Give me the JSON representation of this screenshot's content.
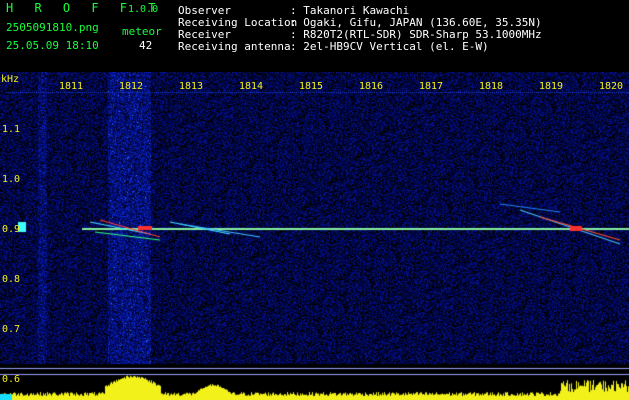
{
  "header": {
    "app_name": "H R O F F T",
    "version": "1.0.0",
    "file_name": "2505091810.png",
    "timestamp": "25.05.09 18:10",
    "count_label": "meteor",
    "count_value": "42",
    "info": [
      {
        "key": "Observer",
        "value": ": Takanori Kawachi"
      },
      {
        "key": "Receiving Location",
        "value": ": Ogaki, Gifu, JAPAN (136.60E, 35.35N)"
      },
      {
        "key": "Receiver",
        "value": ": R820T2(RTL-SDR) SDR-Sharp 53.1000MHz"
      },
      {
        "key": "Receiving antenna",
        "value": ": 2el-HB9CV Vertical (el. E-W)"
      }
    ]
  },
  "axes": {
    "unit_label": "kHz",
    "time_ticks": [
      "1811",
      "1812",
      "1813",
      "1814",
      "1815",
      "1816",
      "1817",
      "1818",
      "1819",
      "1820"
    ],
    "freq_ticks": [
      "1.1",
      "1.0",
      "0.9",
      "0.8",
      "0.7",
      "0.6"
    ]
  },
  "colors": {
    "background": "#000000",
    "header_labels": "#19ff3a",
    "tick_labels": "#f2f21a",
    "noise": "#0a1a8c",
    "signal_line": "#1de0ff"
  }
}
